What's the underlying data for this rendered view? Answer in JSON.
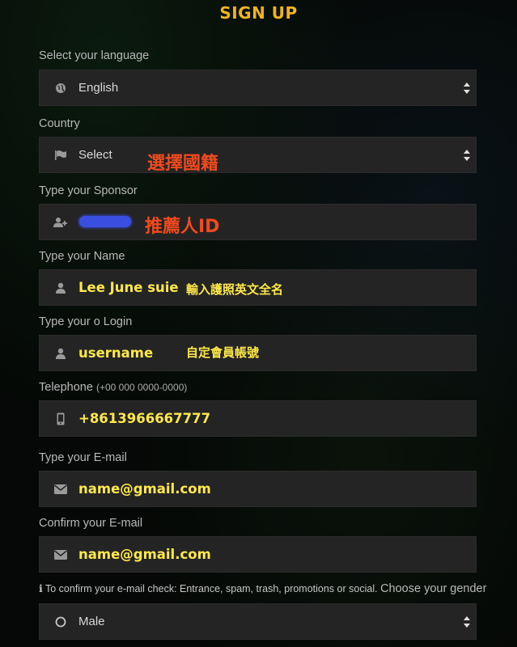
{
  "page": {
    "title": "SIGN UP"
  },
  "language": {
    "label": "Select your language",
    "value": "English",
    "icon": "globe-icon"
  },
  "country": {
    "label": "Country",
    "value": "Select",
    "annotation": "選擇國籍",
    "icon": "flag-icon"
  },
  "sponsor": {
    "label": "Type your Sponsor",
    "annotation": "推薦人ID",
    "icon": "add-user-icon"
  },
  "name": {
    "label": "Type your Name",
    "value": "Lee June suie",
    "annotation": "輸入護照英文全名",
    "icon": "user-icon"
  },
  "login": {
    "label": "Type your o Login",
    "value": "username",
    "annotation": "自定會員帳號",
    "icon": "user-icon"
  },
  "telephone": {
    "label": "Telephone",
    "hint": "(+00 000 0000-0000)",
    "value": "+8613966667777",
    "icon": "mobile-phone-icon"
  },
  "email": {
    "label": "Type your E-mail",
    "value": "name@gmail.com",
    "icon": "envelope-icon"
  },
  "confirm_email": {
    "label": "Confirm your E-mail",
    "value": "name@gmail.com",
    "icon": "envelope-icon"
  },
  "note": {
    "info_icon": "ℹ",
    "text": "To confirm your e-mail check: Entrance, spam, trash, promotions or social.",
    "gender_label": "Choose your gender"
  },
  "gender": {
    "value": "Male",
    "icon": "circle-icon"
  },
  "colors": {
    "title": "#f0b41c",
    "annotation_red": "#f04a1e",
    "annotation_yellow": "#ffe94a",
    "field_bg": "#242424"
  }
}
